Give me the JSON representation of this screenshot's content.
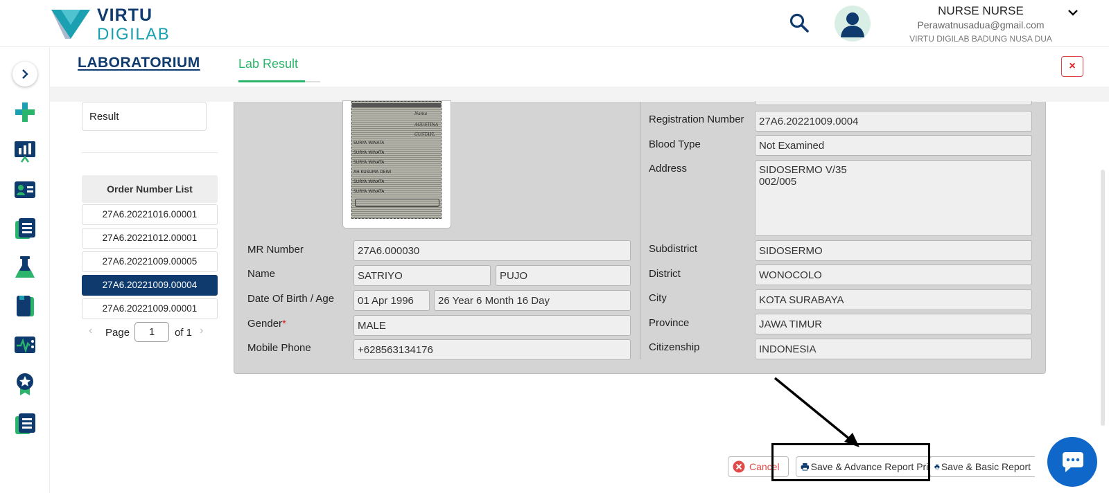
{
  "brand": {
    "line1": "VIRTU",
    "line2": "DIGILAB"
  },
  "user": {
    "name": "NURSE NURSE",
    "email": "Perawatnusadua@gmail.com",
    "org": "VIRTU DIGILAB BADUNG NUSA DUA"
  },
  "tabs": {
    "module": "LABORATORIUM",
    "active": "Lab Result"
  },
  "close_label": "×",
  "left": {
    "result_label": "Result",
    "order_list_title": "Order Number List",
    "orders": [
      "27A6.20221016.00001",
      "27A6.20221012.00001",
      "27A6.20221009.00005",
      "27A6.20221009.00004",
      "27A6.20221009.00001"
    ],
    "selected_order": "27A6.20221009.00004",
    "pager": {
      "prev": "‹",
      "page_label": "Page",
      "page": "1",
      "of_label": "of 1",
      "next": "›"
    }
  },
  "photo_text": {
    "col": [
      "Nama",
      "AGUSTINA",
      "GUSTAYL"
    ],
    "rows": [
      "SURYA WINATA",
      "SURYA WINATA",
      "SURYA WINATA",
      "AH KUSUMA DEWI",
      "SURYA WINATA",
      "SURYA WINATA"
    ]
  },
  "patient": {
    "mr_number_label": "MR Number",
    "mr_number": "27A6.000030",
    "name_label": "Name",
    "first_name": "SATRIYO",
    "last_name": "PUJO",
    "dob_label": "Date Of Birth / Age",
    "dob": "01 Apr 1996",
    "age": "26 Year 6 Month 16 Day",
    "gender_label": "Gender",
    "gender_required": "*",
    "gender": "MALE",
    "phone_label": "Mobile Phone",
    "phone": "+628563134176",
    "reg_label": "Registration Number",
    "reg_number": "27A6.20221009.0004",
    "blood_label": "Blood Type",
    "blood_type": "Not Examined",
    "address_label": "Address",
    "address": "SIDOSERMO V/35\n002/005",
    "subdistrict_label": "Subdistrict",
    "subdistrict": "SIDOSERMO",
    "district_label": "District",
    "district": "WONOCOLO",
    "city_label": "City",
    "city": "KOTA SURABAYA",
    "province_label": "Province",
    "province": "JAWA TIMUR",
    "citizenship_label": "Citizenship",
    "citizenship": "INDONESIA"
  },
  "actions": {
    "cancel": "Cancel",
    "save_advance": "Save & Advance Report Print",
    "save_basic": "Save & Basic Report"
  },
  "colors": {
    "navy": "#0e3a6e",
    "teal": "#1aa0b0",
    "green": "#2bb56c",
    "chat_blue": "#0e67c9"
  }
}
